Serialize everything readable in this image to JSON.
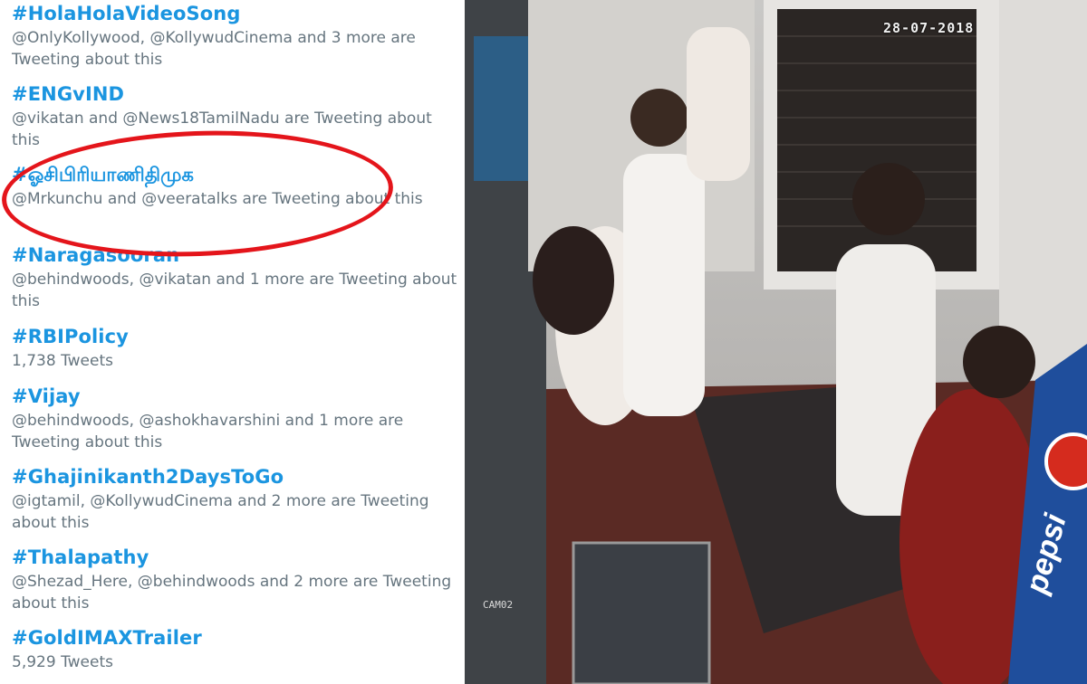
{
  "trends": [
    {
      "hashtag": "#HolaHolaVideoSong",
      "meta": "@OnlyKollywood, @KollywudCinema and 3 more are Tweeting about this"
    },
    {
      "hashtag": "#ENGvIND",
      "meta": "@vikatan and @News18TamilNadu are Tweeting about this"
    },
    {
      "hashtag": "#ஓசிபிரியாணிதிமுக",
      "meta": "@Mrkunchu and @veeratalks are Tweeting about this"
    },
    {
      "hashtag": "#Naragasooran",
      "meta": "@behindwoods, @vikatan and 1 more are Tweeting about this"
    },
    {
      "hashtag": "#RBIPolicy",
      "meta": "1,738 Tweets"
    },
    {
      "hashtag": "#Vijay",
      "meta": "@behindwoods, @ashokhavarshini and 1 more are Tweeting about this"
    },
    {
      "hashtag": "#Ghajinikanth2DaysToGo",
      "meta": "@igtamil, @KollywudCinema and 2 more are Tweeting about this"
    },
    {
      "hashtag": "#Thalapathy",
      "meta": "@Shezad_Here, @behindwoods and 2 more are Tweeting about this"
    },
    {
      "hashtag": "#GoldIMAXTrailer",
      "meta": "5,929 Tweets"
    }
  ],
  "cctv": {
    "timestamp": "28-07-2018",
    "camera_label": "CAM02",
    "sign_text": "pepsi"
  },
  "colors": {
    "hashtag": "#1b95e0",
    "meta": "#66757f",
    "highlight": "#e4151b"
  }
}
